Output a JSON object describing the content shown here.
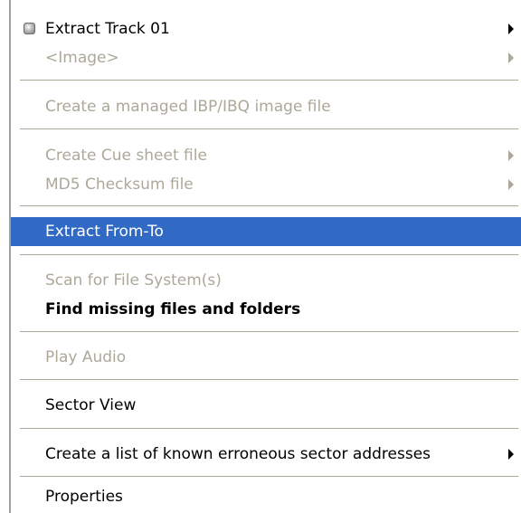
{
  "menu": {
    "items": [
      {
        "label": "Extract Track 01",
        "disabled": false,
        "submenu": true,
        "icon": "disc-icon"
      },
      {
        "label": "<Image>",
        "disabled": true,
        "submenu": true
      },
      {
        "label": "Create a managed IBP/IBQ image file",
        "disabled": true,
        "submenu": false
      },
      {
        "label": "Create Cue sheet file",
        "disabled": true,
        "submenu": true
      },
      {
        "label": "MD5 Checksum file",
        "disabled": true,
        "submenu": true
      },
      {
        "label": "Extract From-To",
        "disabled": false,
        "submenu": false,
        "highlighted": true
      },
      {
        "label": "Scan for File System(s)",
        "disabled": true,
        "submenu": false
      },
      {
        "label": "Find missing files and folders",
        "disabled": false,
        "submenu": false,
        "bold": true
      },
      {
        "label": "Play Audio",
        "disabled": true,
        "submenu": false
      },
      {
        "label": "Sector View",
        "disabled": false,
        "submenu": false
      },
      {
        "label": "Create a list of known erroneous sector addresses",
        "disabled": false,
        "submenu": true
      },
      {
        "label": "Properties",
        "disabled": false,
        "submenu": false
      }
    ]
  },
  "colors": {
    "highlight": "#316ac5",
    "disabled_text": "#aca899",
    "text": "#000000"
  }
}
